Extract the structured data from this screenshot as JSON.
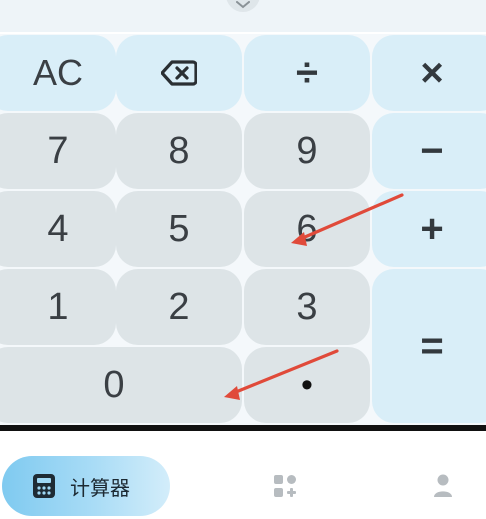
{
  "keypad": {
    "ac": "AC",
    "backspace_icon": "backspace-icon",
    "divide": "÷",
    "multiply": "×",
    "minus": "−",
    "plus": "+",
    "equals": "=",
    "dot": "•",
    "digits": {
      "seven": "7",
      "eight": "8",
      "nine": "9",
      "four": "4",
      "five": "5",
      "six": "6",
      "one": "1",
      "two": "2",
      "three": "3",
      "zero": "0"
    }
  },
  "nav": {
    "calculator_label": "计算器",
    "calculator_icon": "calculator-icon",
    "tools_icon": "grid-plus-icon",
    "profile_icon": "person-icon"
  },
  "colors": {
    "number_key": "#dde4e7",
    "operator_key": "#d9eef8",
    "annotation_arrow": "#e04a3a",
    "nav_active": "#8fd1f2"
  }
}
